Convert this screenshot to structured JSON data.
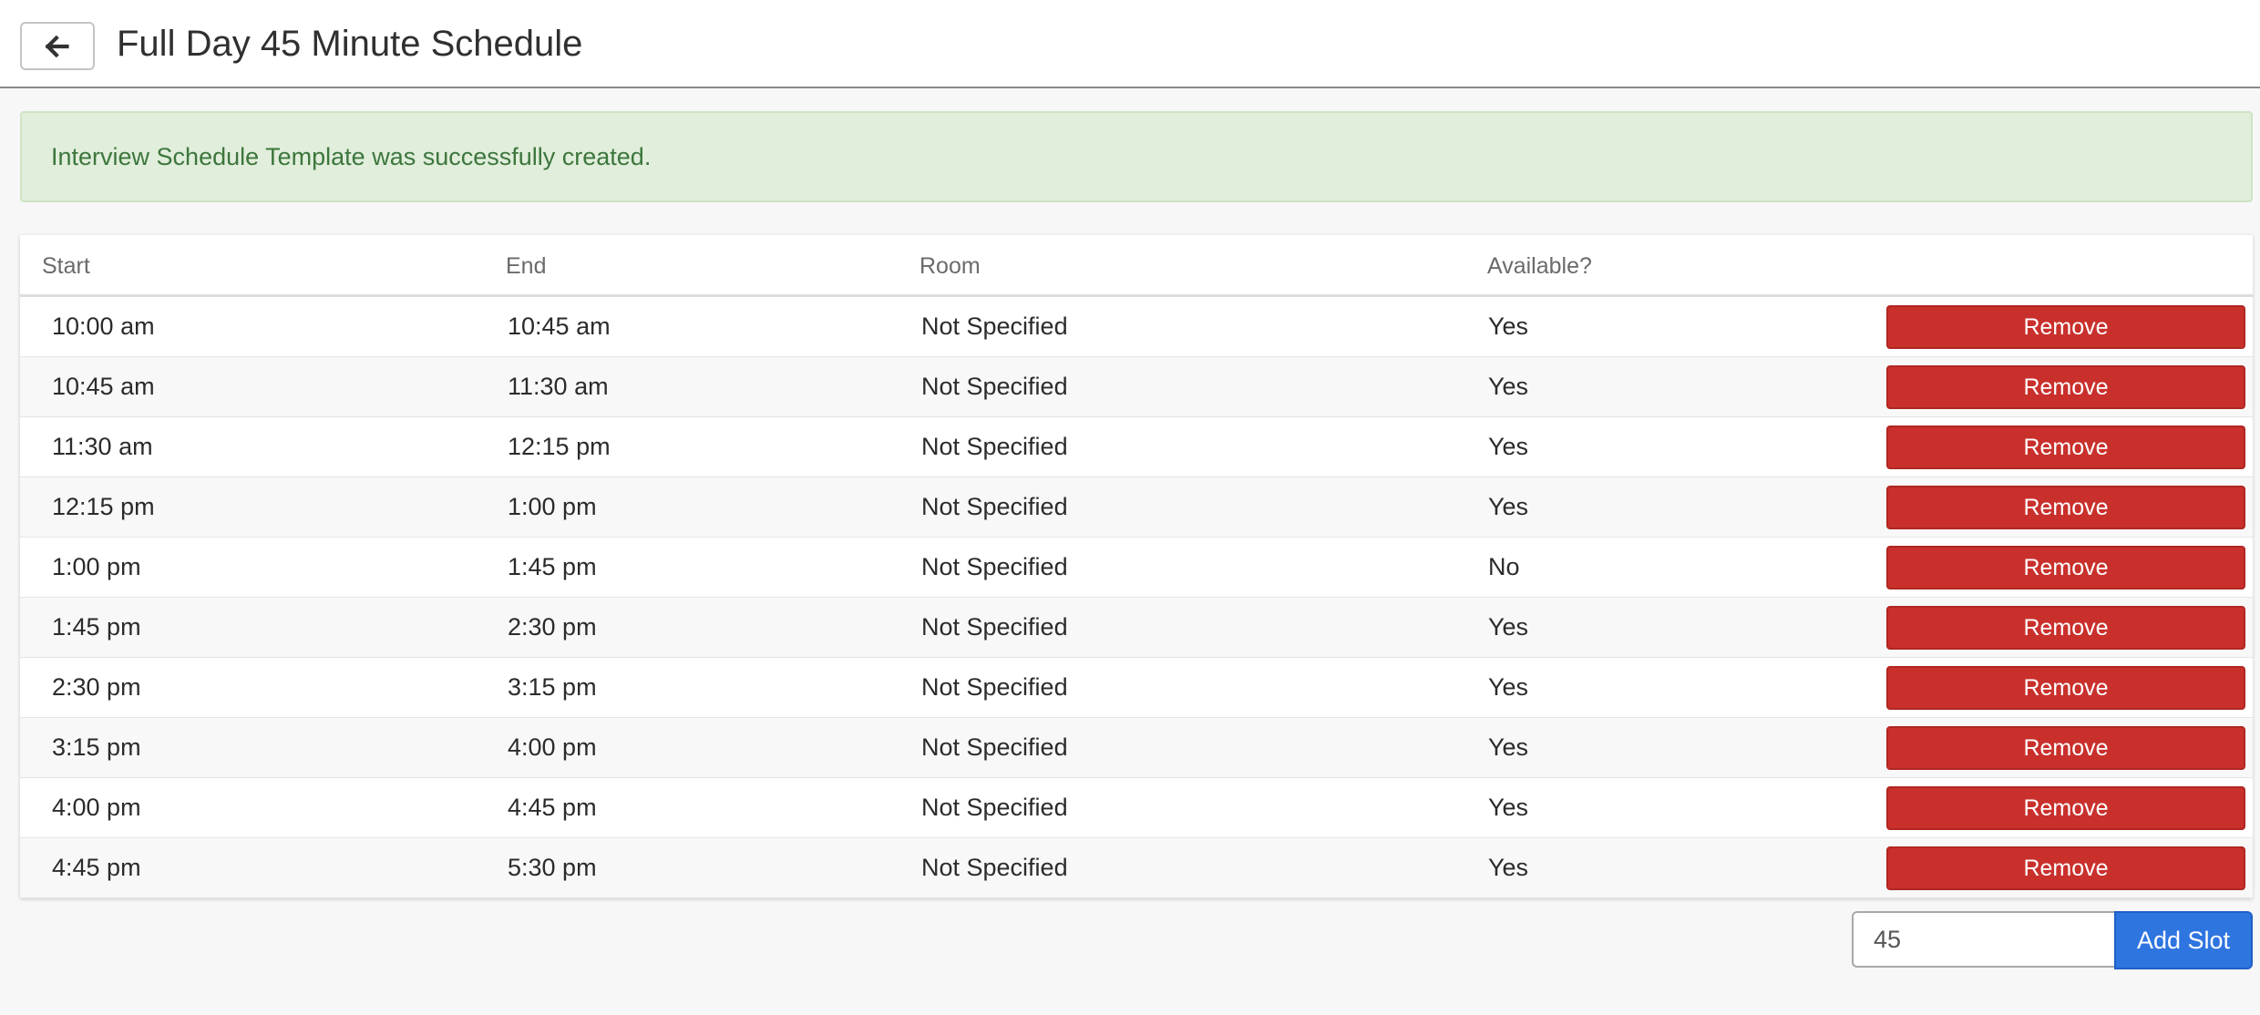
{
  "header": {
    "title": "Full Day 45 Minute Schedule",
    "back_icon": "arrow-left-icon"
  },
  "alert": {
    "message": "Interview Schedule Template was successfully created.",
    "color": "#3c763d",
    "background": "#e1eedb"
  },
  "table": {
    "columns": {
      "start": "Start",
      "end": "End",
      "room": "Room",
      "available": "Available?"
    },
    "rows": [
      {
        "start": "10:00 am",
        "end": "10:45 am",
        "room": "Not Specified",
        "available": "Yes",
        "action": "Remove"
      },
      {
        "start": "10:45 am",
        "end": "11:30 am",
        "room": "Not Specified",
        "available": "Yes",
        "action": "Remove"
      },
      {
        "start": "11:30 am",
        "end": "12:15 pm",
        "room": "Not Specified",
        "available": "Yes",
        "action": "Remove"
      },
      {
        "start": "12:15 pm",
        "end": "1:00 pm",
        "room": "Not Specified",
        "available": "Yes",
        "action": "Remove"
      },
      {
        "start": "1:00 pm",
        "end": "1:45 pm",
        "room": "Not Specified",
        "available": "No",
        "action": "Remove"
      },
      {
        "start": "1:45 pm",
        "end": "2:30 pm",
        "room": "Not Specified",
        "available": "Yes",
        "action": "Remove"
      },
      {
        "start": "2:30 pm",
        "end": "3:15 pm",
        "room": "Not Specified",
        "available": "Yes",
        "action": "Remove"
      },
      {
        "start": "3:15 pm",
        "end": "4:00 pm",
        "room": "Not Specified",
        "available": "Yes",
        "action": "Remove"
      },
      {
        "start": "4:00 pm",
        "end": "4:45 pm",
        "room": "Not Specified",
        "available": "Yes",
        "action": "Remove"
      },
      {
        "start": "4:45 pm",
        "end": "5:30 pm",
        "room": "Not Specified",
        "available": "Yes",
        "action": "Remove"
      }
    ],
    "remove_color": "#c9302c"
  },
  "add_slot": {
    "duration_value": "45",
    "button_label": "Add Slot",
    "button_color": "#2e75e0"
  }
}
